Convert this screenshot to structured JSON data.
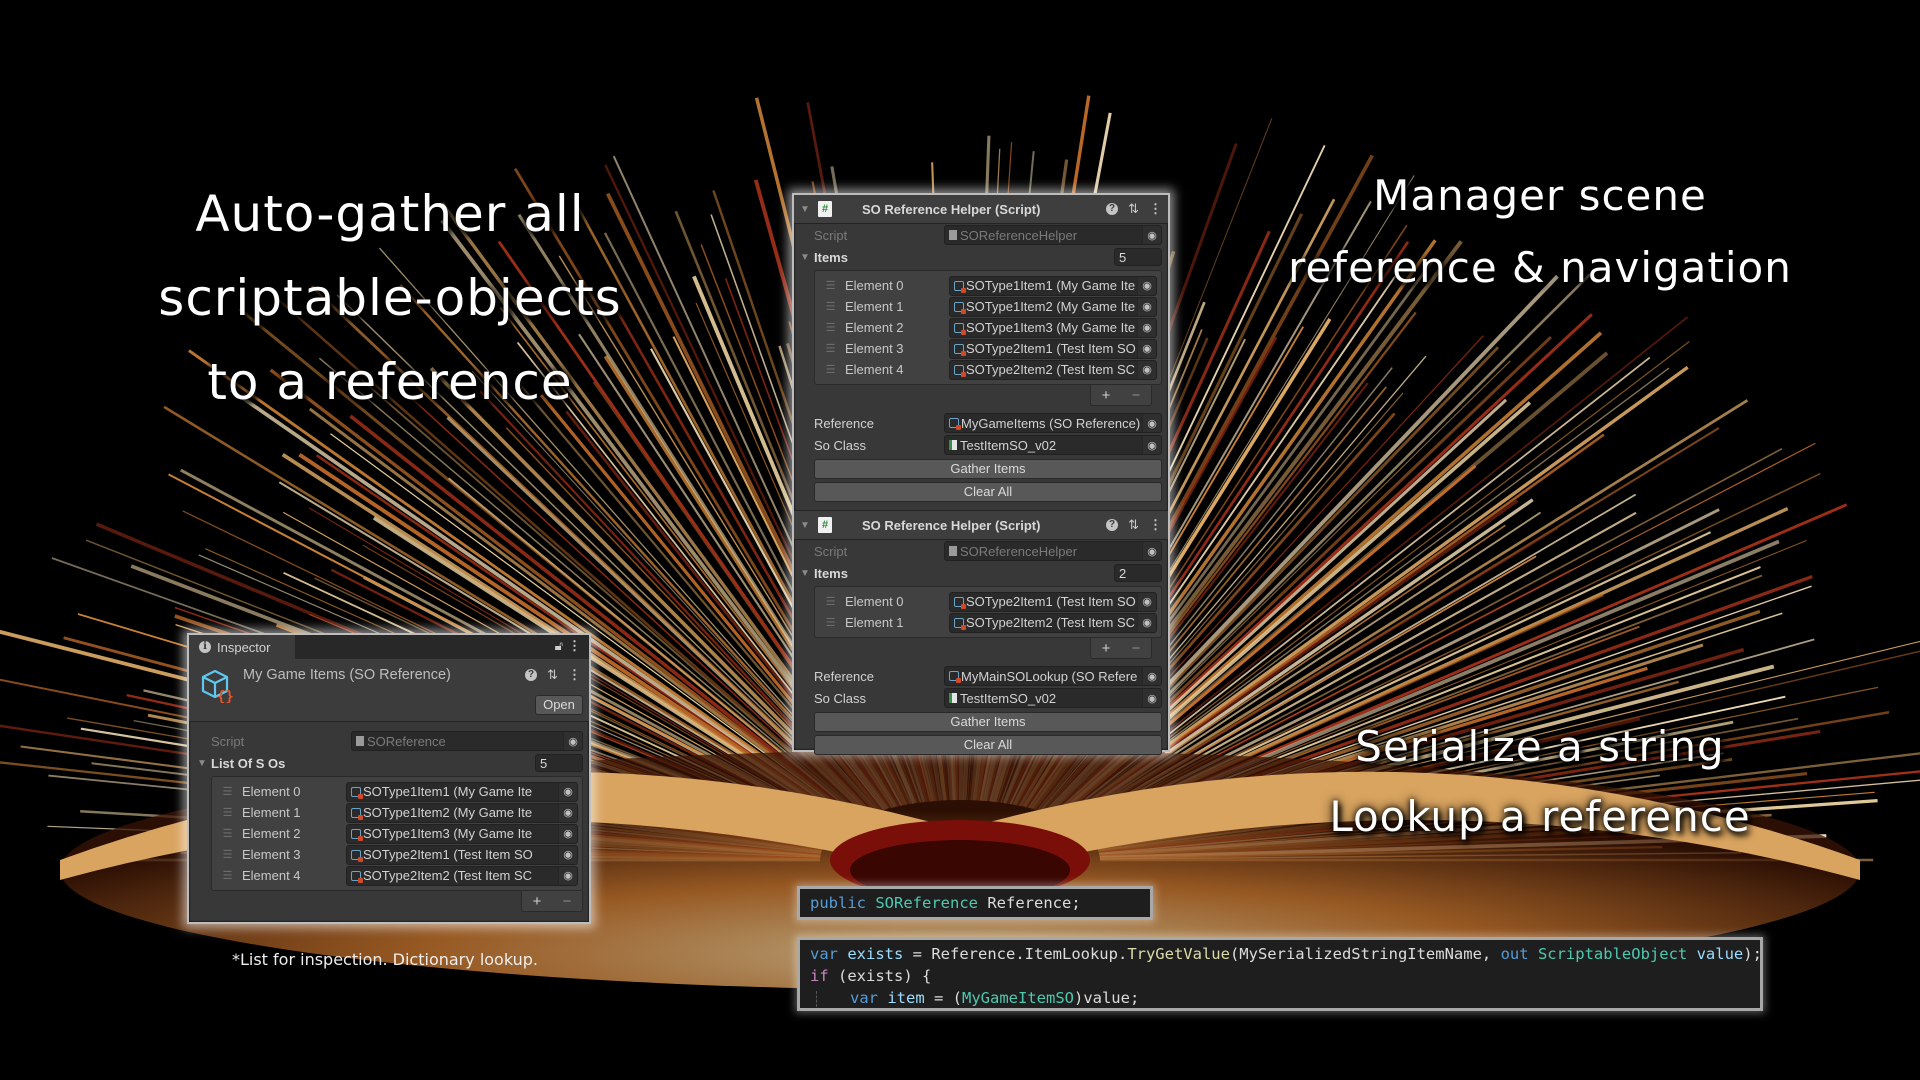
{
  "headlines": {
    "left": [
      "Auto-gather all",
      "scriptable-objects",
      "to a reference"
    ],
    "right": [
      "Manager scene",
      "reference & navigation"
    ],
    "bottom_right": [
      "Serialize a string",
      "Lookup a reference"
    ],
    "footnote": "*List for inspection. Dictionary lookup."
  },
  "inspector": {
    "tab_label": "Inspector",
    "tab_icon": "info-icon",
    "asset_title": "My Game Items (SO Reference)",
    "open_label": "Open",
    "script_label": "Script",
    "script_value": "SOReference",
    "list_label": "List Of S Os",
    "list_count": "5",
    "elements": [
      {
        "label": "Element 0",
        "value": "SOType1Item1 (My Game Ite"
      },
      {
        "label": "Element 1",
        "value": "SOType1Item2 (My Game Ite"
      },
      {
        "label": "Element 2",
        "value": "SOType1Item3 (My Game Ite"
      },
      {
        "label": "Element 3",
        "value": "SOType2Item1 (Test Item SO"
      },
      {
        "label": "Element 4",
        "value": "SOType2Item2 (Test Item SC"
      }
    ],
    "add_label": "+",
    "remove_label": "−"
  },
  "helpers": [
    {
      "title": "SO Reference Helper (Script)",
      "script_label": "Script",
      "script_value": "SOReferenceHelper",
      "items_label": "Items",
      "items_count": "5",
      "elements": [
        {
          "label": "Element 0",
          "value": "SOType1Item1 (My Game Ite"
        },
        {
          "label": "Element 1",
          "value": "SOType1Item2 (My Game Ite"
        },
        {
          "label": "Element 2",
          "value": "SOType1Item3 (My Game Ite"
        },
        {
          "label": "Element 3",
          "value": "SOType2Item1 (Test Item SO"
        },
        {
          "label": "Element 4",
          "value": "SOType2Item2 (Test Item SC"
        }
      ],
      "reference_label": "Reference",
      "reference_value": "MyGameItems (SO Reference)",
      "soclass_label": "So Class",
      "soclass_value": "TestItemSO_v02",
      "gather_label": "Gather Items",
      "clear_label": "Clear All"
    },
    {
      "title": "SO Reference Helper (Script)",
      "script_label": "Script",
      "script_value": "SOReferenceHelper",
      "items_label": "Items",
      "items_count": "2",
      "elements": [
        {
          "label": "Element 0",
          "value": "SOType2Item1 (Test Item SO"
        },
        {
          "label": "Element 1",
          "value": "SOType2Item2 (Test Item SC"
        }
      ],
      "reference_label": "Reference",
      "reference_value": "MyMainSOLookup (SO Refere",
      "soclass_label": "So Class",
      "soclass_value": "TestItemSO_v02",
      "gather_label": "Gather Items",
      "clear_label": "Clear All"
    }
  ],
  "code": {
    "declaration": {
      "kw": "public",
      "type": "SOReference",
      "name": "Reference;"
    },
    "lookup": {
      "l1_kw": "var",
      "l1_var": "exists",
      "l1_eq": " = Reference.ItemLookup.",
      "l1_fn": "TryGetValue",
      "l1_arg": "(MySerializedStringItemName, ",
      "l1_out": "out",
      "l1_type": "ScriptableObject",
      "l1_val": "value",
      "l1_end": ");",
      "l2_kw": "if",
      "l2_rest": " (exists) {",
      "l3_kw": "var",
      "l3_var": "item",
      "l3_eq": " = (",
      "l3_type": "MyGameItemSO",
      "l3_end": ")value;"
    }
  },
  "colors": {
    "unity_panel_bg": "#383838",
    "code_bg": "#1e1e1e",
    "keyword": "#569cd6",
    "type": "#4ec9b0"
  }
}
